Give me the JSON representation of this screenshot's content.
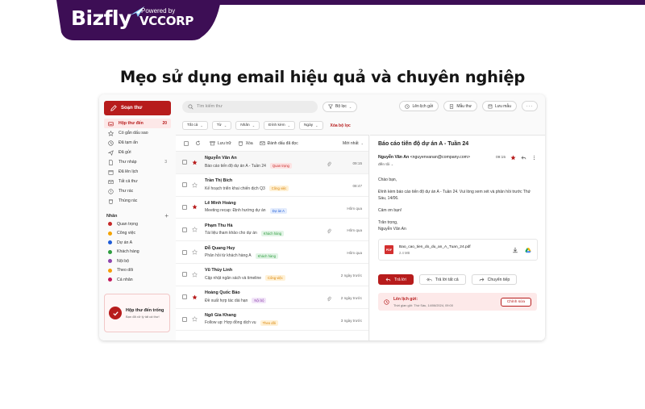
{
  "banner": {
    "brand": "Bizfly",
    "powered_by": "Powered by",
    "partner": "VCCORP",
    "bg_color": "#3d0e55"
  },
  "headline": "Mẹo sử dụng email hiệu quả và chuyên nghiệp",
  "accent_color": "#b71c1c",
  "sidebar": {
    "compose": "Soạn thư",
    "nav": [
      {
        "label": "Hộp thư đến",
        "count": "20",
        "icon": "inbox-icon",
        "active": true
      },
      {
        "label": "Có gắn dấu sao",
        "count": "",
        "icon": "star-icon"
      },
      {
        "label": "Đã tạm ẩn",
        "count": "",
        "icon": "clock-icon"
      },
      {
        "label": "Đã gửi",
        "count": "",
        "icon": "send-icon"
      },
      {
        "label": "Thư nháp",
        "count": "3",
        "icon": "draft-icon"
      },
      {
        "label": "Đã lên lịch",
        "count": "",
        "icon": "calendar-icon"
      },
      {
        "label": "Tất cả thư",
        "count": "",
        "icon": "mail-icon"
      },
      {
        "label": "Thư rác",
        "count": "",
        "icon": "spam-icon"
      },
      {
        "label": "Thùng rác",
        "count": "",
        "icon": "trash-icon"
      }
    ],
    "labels_title": "Nhãn",
    "labels": [
      {
        "label": "Quan trọng",
        "color": "#c62828"
      },
      {
        "label": "Công việc",
        "color": "#f4a300"
      },
      {
        "label": "Dự án A",
        "color": "#1e5cd8"
      },
      {
        "label": "Khách hàng",
        "color": "#2e9d3f"
      },
      {
        "label": "Nội bộ",
        "color": "#8e44ad"
      },
      {
        "label": "Theo dõi",
        "color": "#f59e0b"
      },
      {
        "label": "Cá nhân",
        "color": "#c2185b"
      }
    ],
    "empty_title": "Hộp thư đến trống",
    "empty_sub": "Bạn đã xử lý tất cả thư!"
  },
  "topbar": {
    "search_placeholder": "Tìm kiếm thư",
    "filter": "Bộ lọc",
    "schedule_send": "Lên lịch gửi",
    "template": "Mẫu thư",
    "save_template": "Lưu mẫu"
  },
  "filters": {
    "chips": [
      "Tất cả",
      "Từ",
      "Nhãn",
      "Đính kèm",
      "Ngày"
    ],
    "clear": "Xóa bộ lọc"
  },
  "list_toolbar": {
    "save": "Lưu trữ",
    "delete": "Xóa",
    "mark_read": "Đánh dấu đã đọc",
    "sort": "Mới nhất"
  },
  "emails": [
    {
      "sender": "Nguyễn Văn An",
      "subject": "Báo cáo tiến độ dự án A - Tuần 24",
      "tag": "Quan trọng",
      "tag_color": "#c62828",
      "tag_bg": "#fde3e3",
      "time": "09:15",
      "starred": true,
      "attachment": true,
      "selected": true
    },
    {
      "sender": "Trần Thị Bích",
      "subject": "Kế hoạch triển khai chiến dịch Q3",
      "tag": "Công việc",
      "tag_color": "#d98200",
      "tag_bg": "#fff1d6",
      "time": "08:47",
      "starred": false,
      "attachment": false
    },
    {
      "sender": "Lê Minh Hoàng",
      "subject": "Meeting recap: Định hướng dự án",
      "tag": "Dự án A",
      "tag_color": "#1e5cd8",
      "tag_bg": "#e3ecfd",
      "time": "Hôm qua",
      "starred": true,
      "attachment": false
    },
    {
      "sender": "Phạm Thu Hà",
      "subject": "Tài liệu tham khảo cho dự án",
      "tag": "Khách hàng",
      "tag_color": "#2e9d3f",
      "tag_bg": "#e2f4e6",
      "time": "Hôm qua",
      "starred": false,
      "attachment": true
    },
    {
      "sender": "Đỗ Quang Huy",
      "subject": "Phản hồi từ khách hàng A",
      "tag": "Khách hàng",
      "tag_color": "#2e9d3f",
      "tag_bg": "#e2f4e6",
      "time": "Hôm qua",
      "starred": false,
      "attachment": false
    },
    {
      "sender": "Vũ Thùy Linh",
      "subject": "Cập nhật ngân sách và timeline",
      "tag": "Công việc",
      "tag_color": "#d98200",
      "tag_bg": "#fff1d6",
      "time": "2 ngày trước",
      "starred": false,
      "attachment": false
    },
    {
      "sender": "Hoàng Quốc Bảo",
      "subject": "Đề xuất hợp tác dài hạn",
      "tag": "Nội bộ",
      "tag_color": "#8e44ad",
      "tag_bg": "#f1e4f8",
      "time": "2 ngày trước",
      "starred": true,
      "attachment": true
    },
    {
      "sender": "Ngô Gia Khang",
      "subject": "Follow up: Hợp đồng dịch vụ",
      "tag": "Theo dõi",
      "tag_color": "#d98200",
      "tag_bg": "#fff1d6",
      "time": "3 ngày trước",
      "starred": false,
      "attachment": false
    }
  ],
  "reading": {
    "title": "Báo cáo tiến độ dự án A - Tuần 24",
    "from_name": "Nguyễn Văn An",
    "from_email": "<nguyenvanan@company.com>",
    "to": "đến tôi",
    "time": "09:15",
    "greeting": "Chào bạn,",
    "body": "Đính kèm báo cáo tiến độ dự án A - Tuần 24. Vui lòng xem xét và phản hồi trước Thứ Sáu, 14/06.",
    "thanks": "Cảm ơn bạn!",
    "sign_1": "Trân trọng,",
    "sign_2": "Nguyễn Văn An",
    "attachment_name": "Bao_cao_tien_do_du_an_A_Tuan_24.pdf",
    "attachment_size": "2.4 MB",
    "pdf": "PDF",
    "reply": "Trả lời",
    "reply_all": "Trả lời tất cả",
    "forward": "Chuyển tiếp",
    "schedule_title": "Lên lịch gửi:",
    "schedule_sub": "Thời gian gửi: Thứ Sáu, 14/06/2024, 09:00",
    "edit": "Chỉnh sửa"
  }
}
